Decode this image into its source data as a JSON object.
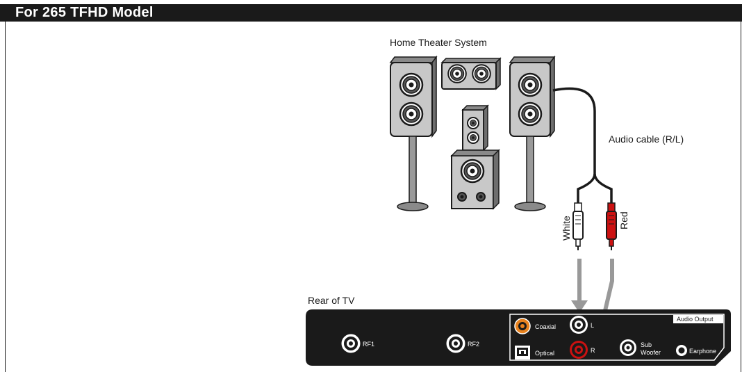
{
  "header": {
    "title": "For 265 TFHD Model"
  },
  "diagram": {
    "home_theater_label": "Home Theater System",
    "cable_label": "Audio cable (R/L)",
    "white_plug_label": "White",
    "red_plug_label": "Red",
    "rear_tv_label": "Rear of TV",
    "rf1_label": "RF1",
    "rf2_label": "RF2",
    "audio_output_label": "Audio Output",
    "coaxial_label": "Coaxial",
    "optical_label": "Optical",
    "left_jack_label": "L",
    "right_jack_label": "R",
    "sub_label_1": "Sub",
    "sub_label_2": "Woofer",
    "earphone_label": "Earphone"
  },
  "colors": {
    "red_accent": "#cc1111",
    "orange_accent": "#e8821e",
    "arrow_gray": "#999999",
    "panel_black": "#1a1a1a"
  }
}
